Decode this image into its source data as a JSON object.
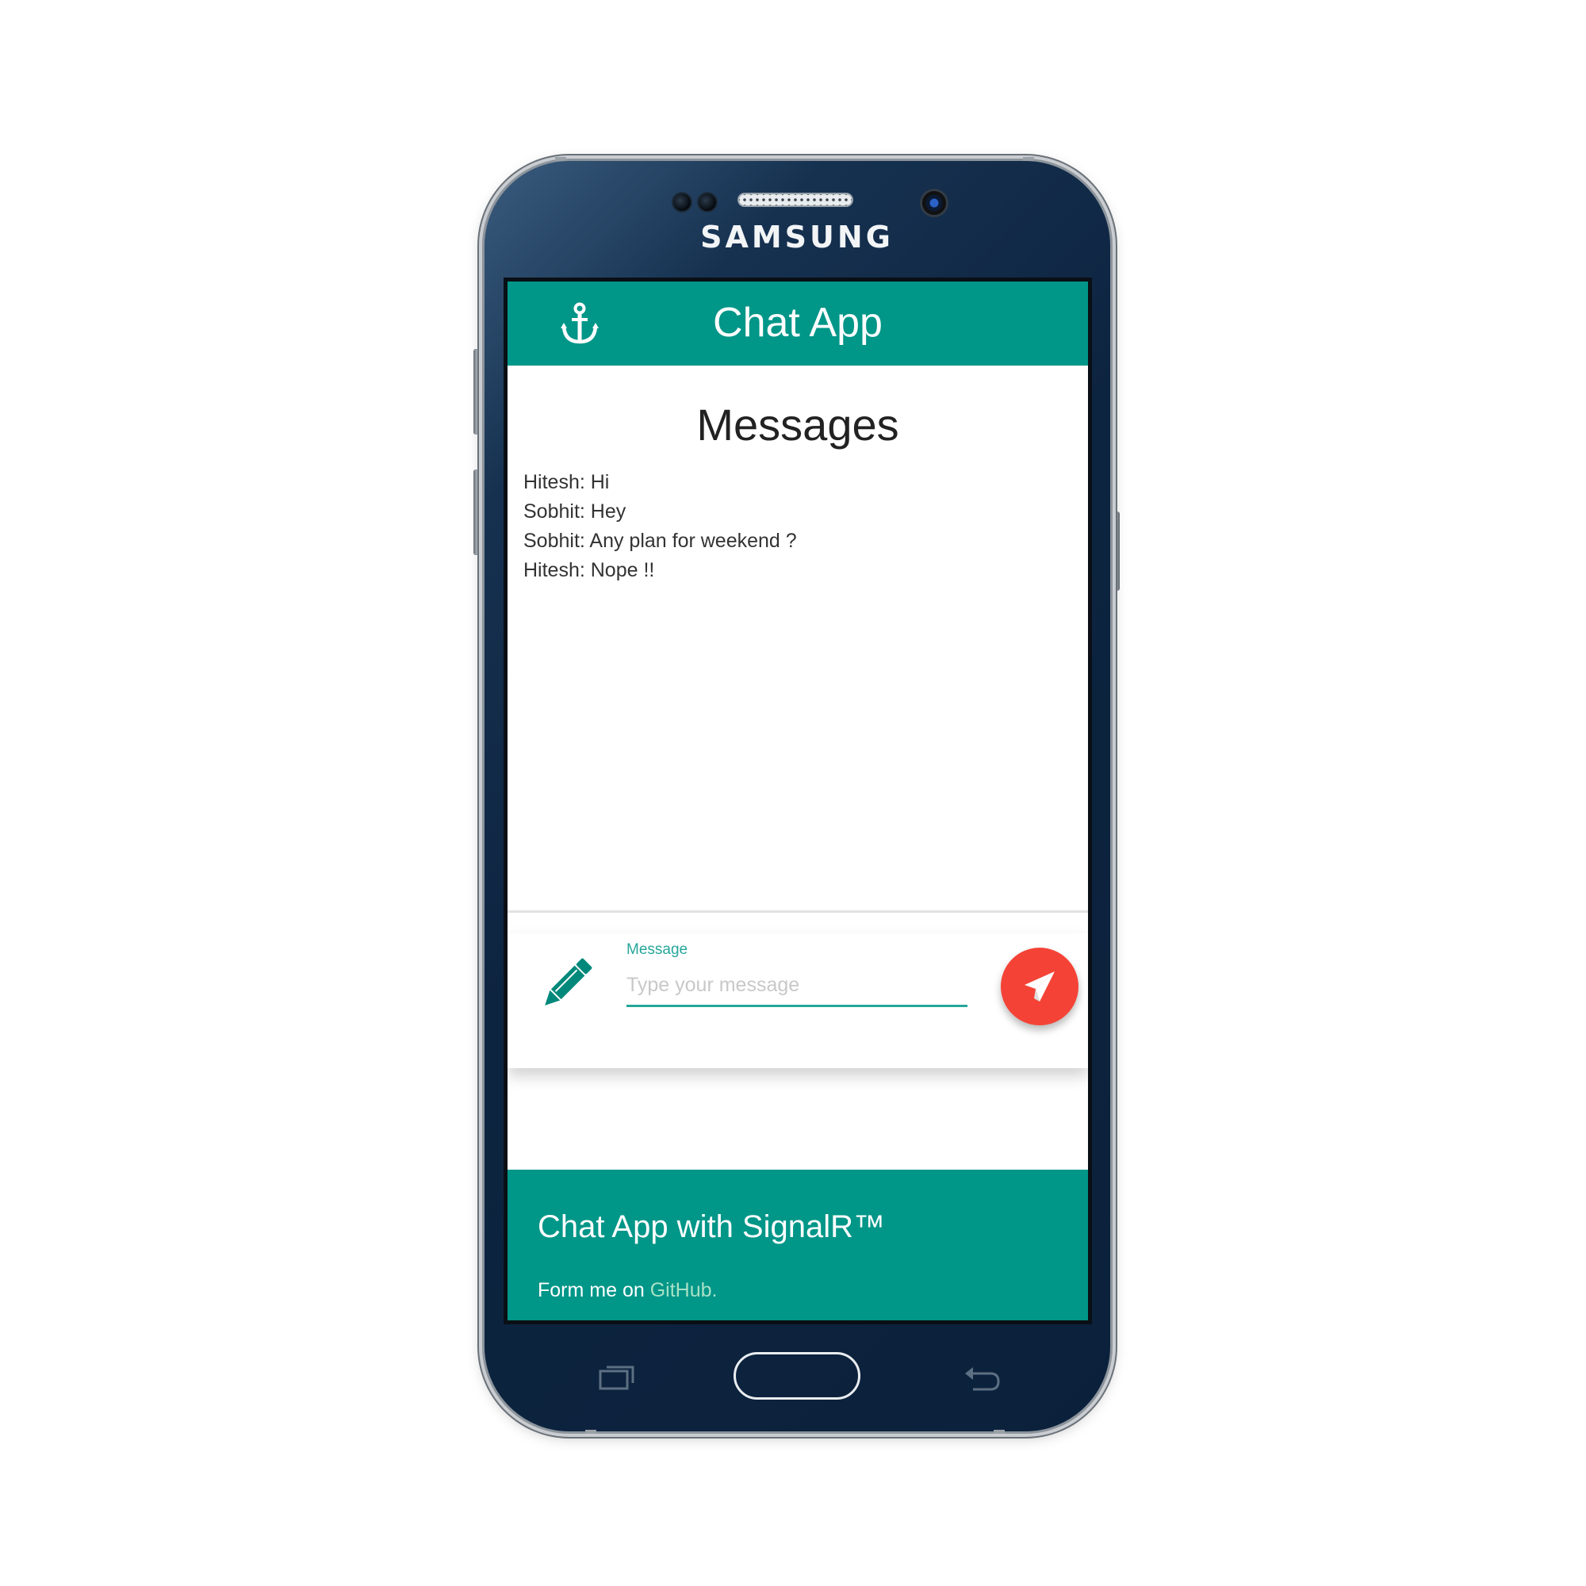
{
  "device": {
    "brand": "SAMSUNG"
  },
  "appbar": {
    "title": "Chat App",
    "icon": "anchor-icon"
  },
  "messages": {
    "heading": "Messages",
    "items": [
      "Hitesh: Hi",
      "Sobhit: Hey",
      "Sobhit: Any plan for weekend ?",
      "Hitesh: Nope !!"
    ]
  },
  "composer": {
    "label": "Message",
    "placeholder": "Type your message",
    "value": "",
    "icon": "pencil-icon",
    "send_icon": "send-icon"
  },
  "footer": {
    "title": "Chat App with SignalR™",
    "text_prefix": "Form me on",
    "link_text": "GitHub."
  },
  "colors": {
    "primary": "#009688",
    "accent": "#f44336",
    "input_line": "#26a69a",
    "link": "#a7e1c5",
    "phone_body": "#0d2440"
  }
}
